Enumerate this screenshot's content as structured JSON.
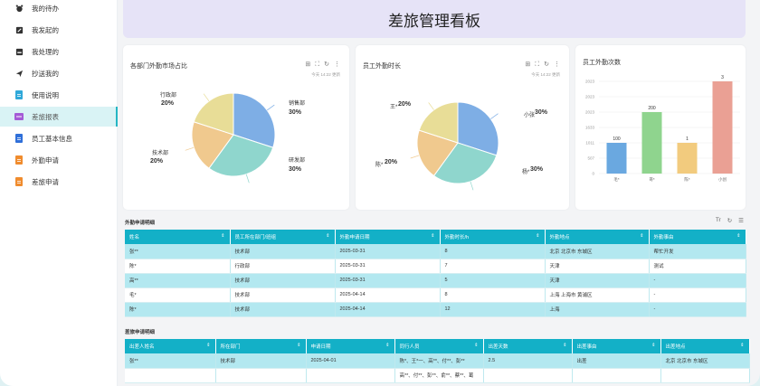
{
  "sidebar": {
    "items": [
      {
        "label": "我的待办",
        "icon": "alarm-icon",
        "color": "#333333"
      },
      {
        "label": "我发起的",
        "icon": "edit-icon",
        "color": "#333333"
      },
      {
        "label": "我处理的",
        "icon": "inbox-icon",
        "color": "#333333"
      },
      {
        "label": "抄送我的",
        "icon": "send-icon",
        "color": "#333333"
      },
      {
        "label": "使用说明",
        "icon": "document-icon",
        "color": "#2fa8d9"
      },
      {
        "label": "差旅报表",
        "icon": "report-icon",
        "color": "#a45bd6",
        "active": true
      },
      {
        "label": "员工基本信息",
        "icon": "document-icon",
        "color": "#2f6fd9"
      },
      {
        "label": "外勤申请",
        "icon": "document-icon",
        "color": "#f08c2e"
      },
      {
        "label": "差旅申请",
        "icon": "document-icon",
        "color": "#f08c2e"
      }
    ]
  },
  "header": {
    "title": "差旅管理看板"
  },
  "cards": {
    "pie1": {
      "title": "各部门外勤市场占比",
      "sub": "今天 14:22 更新",
      "tools": [
        "表格",
        "全屏",
        "刷新",
        "更多"
      ]
    },
    "pie2": {
      "title": "员工外勤时长",
      "sub": "今天 14:22 更新",
      "tools": [
        "表格",
        "全屏",
        "刷新",
        "更多"
      ]
    },
    "bar": {
      "title": "员工外勤次数"
    }
  },
  "chart_data": [
    {
      "type": "pie",
      "title": "各部门外勤市场占比",
      "labels": [
        "销售部",
        "研发部",
        "技术部",
        "行政部"
      ],
      "values": [
        30,
        30,
        20,
        20
      ],
      "pct_labels": [
        "30%",
        "30%",
        "20%",
        "20%"
      ],
      "colors": [
        "#7eaee5",
        "#8fd6cd",
        "#f0c98e",
        "#e8dd97"
      ]
    },
    {
      "type": "pie",
      "title": "员工外勤时长",
      "labels": [
        "小张",
        "杨*",
        "陈*",
        "王*"
      ],
      "values": [
        30,
        30,
        20,
        20
      ],
      "pct_labels": [
        "30%",
        "30%",
        "20%",
        "20%"
      ],
      "colors": [
        "#7eaee5",
        "#8fd6cd",
        "#f0c98e",
        "#e8dd97"
      ]
    },
    {
      "type": "bar",
      "title": "员工外勤次数",
      "categories": [
        "毛*",
        "哥*",
        "陈*",
        "小创"
      ],
      "values": [
        100,
        200,
        1,
        3
      ],
      "value_labels": [
        "100",
        "200",
        "1",
        "3"
      ],
      "colors": [
        "#6aa8e0",
        "#8fd48e",
        "#f2cb7e",
        "#eaa094"
      ],
      "yticks": [
        "2023",
        "2023",
        "2023",
        "1633",
        "1011",
        "507",
        "0"
      ],
      "grid": true
    }
  ],
  "waiqin_table": {
    "title": "外勤申请明细",
    "tools": [
      "Tr",
      "刷新",
      "列表"
    ],
    "columns": [
      "姓名",
      "员工所在部门/班组",
      "外勤申请日期",
      "外勤时长/h",
      "外勤地点",
      "外勤事由"
    ],
    "rows": [
      [
        "张**",
        "技术部",
        "2025-03-31",
        "8",
        "北京 北京市 东城区",
        "帮忙开发"
      ],
      [
        "陈*",
        "行政部",
        "2025-03-31",
        "7",
        "天津",
        "测试"
      ],
      [
        "高**",
        "技术部",
        "2025-03-31",
        "5",
        "天津",
        "-"
      ],
      [
        "毛*",
        "技术部",
        "2025-04-14",
        "8",
        "上海 上海市 黄浦区",
        "-"
      ],
      [
        "陈*",
        "技术部",
        "2025-04-14",
        "12",
        "上海",
        "-"
      ]
    ]
  },
  "chailv_table": {
    "title": "差旅申请明细",
    "columns": [
      "出差人姓名",
      "所在部门",
      "申请日期",
      "同行人员",
      "出差天数",
      "出差事由",
      "出差地点"
    ],
    "rows": [
      [
        "张**",
        "技术部",
        "2025-04-01",
        "陈*、王*一、高**、付**、彭**",
        "2.5",
        "出差",
        "北京 北京市 东城区"
      ],
      [
        "",
        "",
        "",
        "高**、付**、彭**、俞**、蔡**、葛",
        "",
        "",
        ""
      ]
    ]
  }
}
